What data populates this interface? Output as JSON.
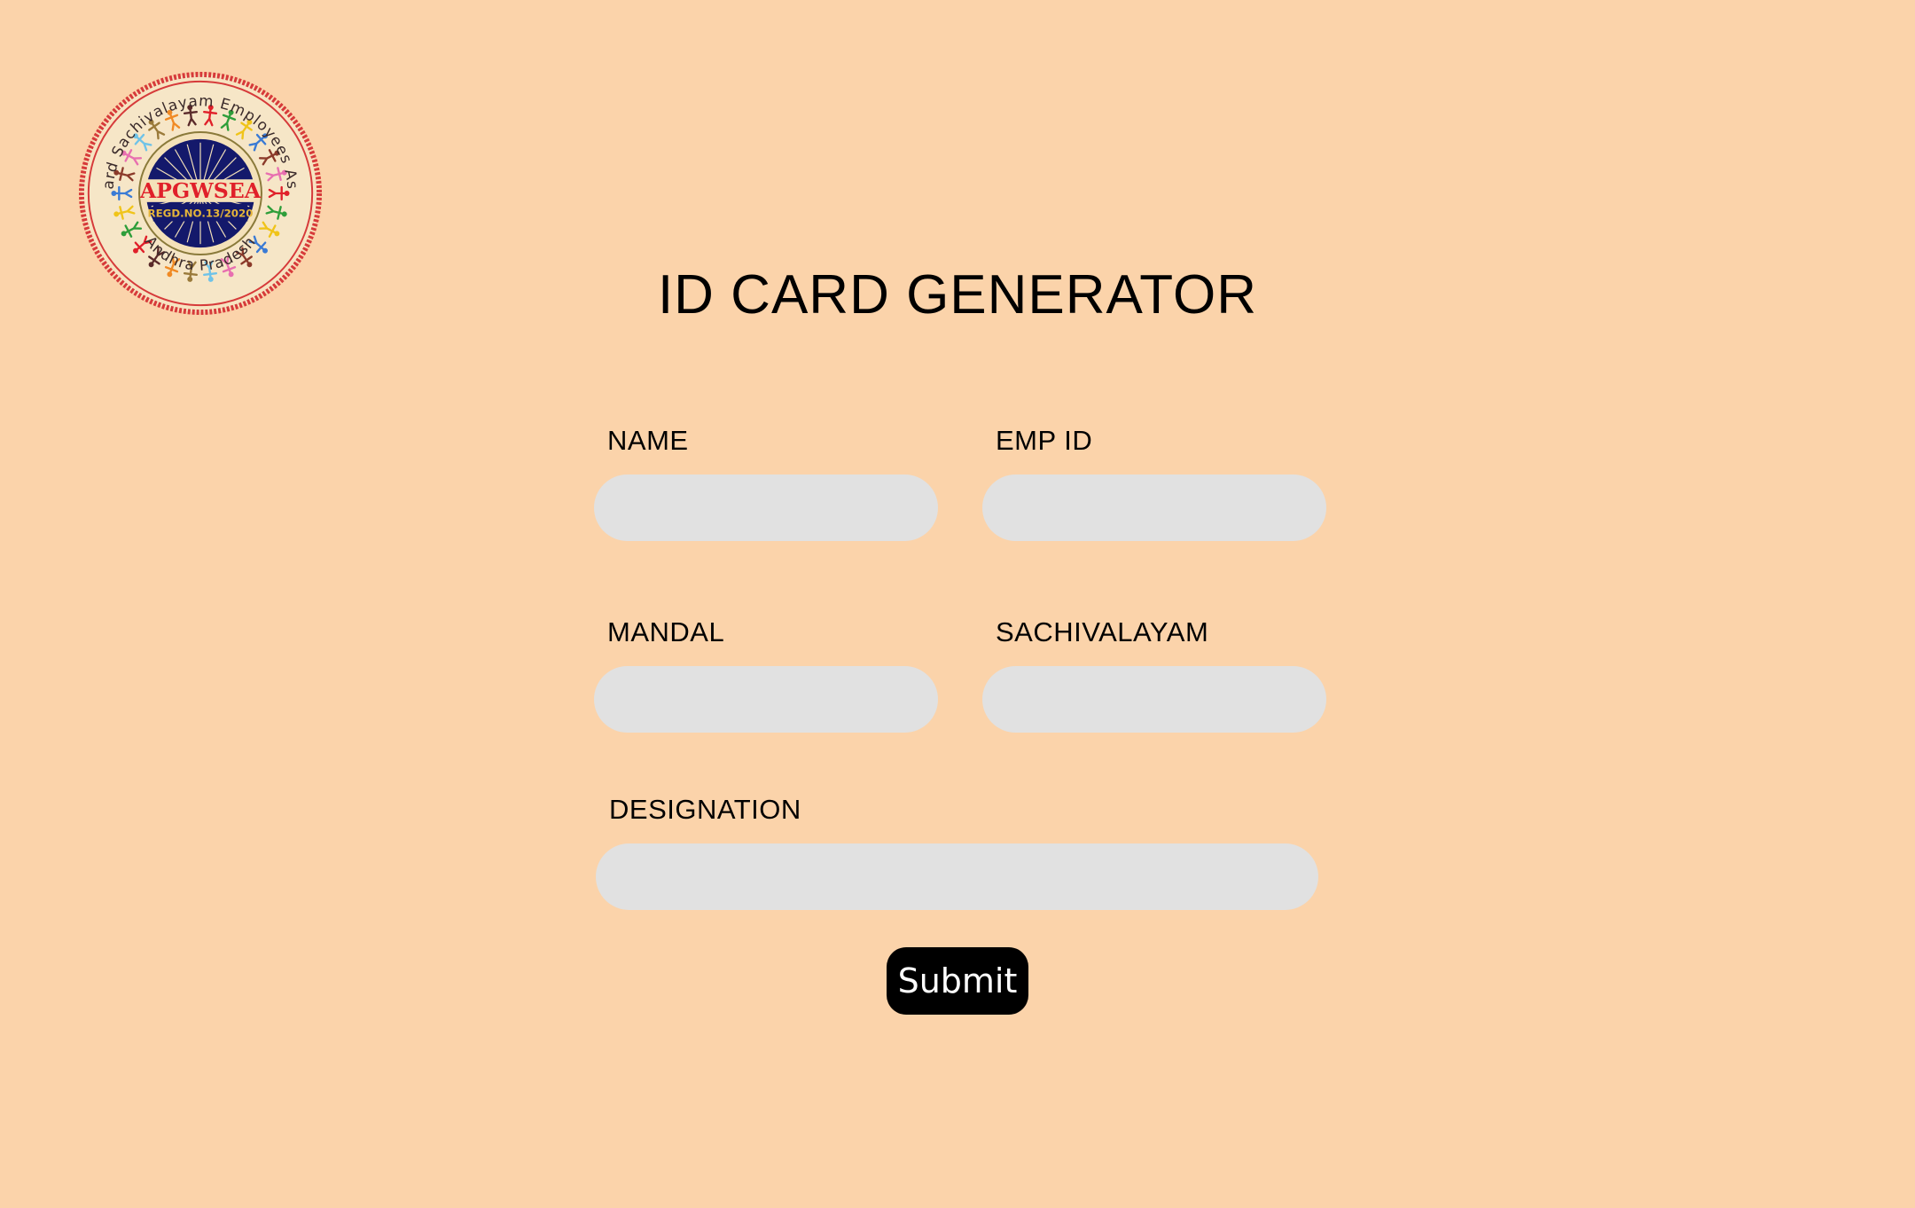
{
  "logo": {
    "name": "APGWSEA",
    "outer_text": "Grama Ward Sachivalayam Employees Association",
    "bottom_text": "Andhra Pradesh",
    "center_text": "APGWSEA",
    "reg_text": "REGD.NO.13/2020",
    "colors": {
      "ring": "#D63A3A",
      "inner_navy": "#14196B",
      "badge_red": "#E0202A",
      "badge_gold": "#E4B43A",
      "band": "#F4E1B9"
    }
  },
  "title": "ID CARD GENERATOR",
  "form": {
    "name_label": "NAME",
    "name_value": "",
    "empid_label": "EMP ID",
    "empid_value": "",
    "mandal_label": "MANDAL",
    "mandal_value": "",
    "sachivalayam_label": "SACHIVALAYAM",
    "sachivalayam_value": "",
    "designation_label": "DESIGNATION",
    "designation_value": "",
    "submit_label": "Submit"
  },
  "colors": {
    "background": "#FBD3AA",
    "input_background": "#E1E1E1",
    "button_background": "#000000",
    "button_text": "#FFFFFF"
  }
}
